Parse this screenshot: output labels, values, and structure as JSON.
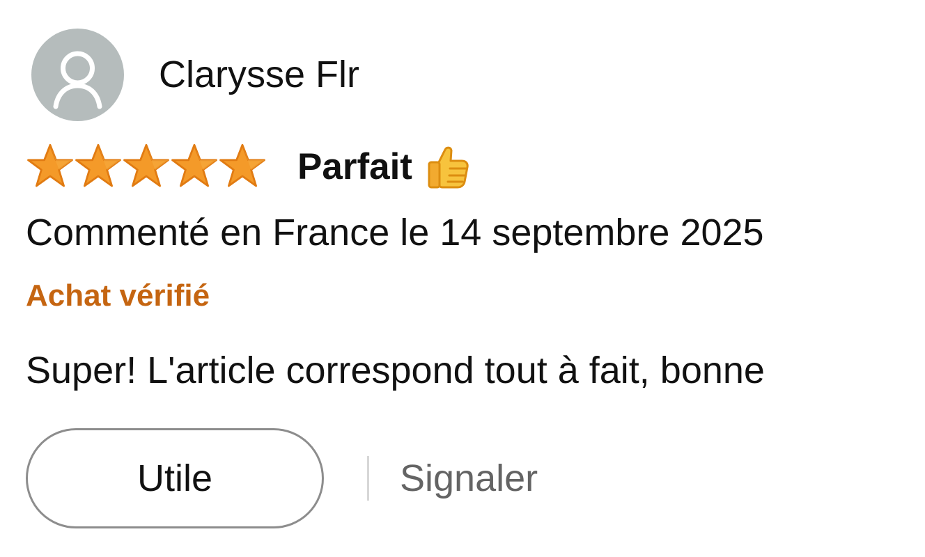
{
  "review": {
    "author": {
      "name": "Clarysse Flr",
      "avatar_icon": "person-outline-icon",
      "avatar_color": "#b5bcbc"
    },
    "rating": {
      "value": 5,
      "max": 5,
      "star_icon": "star-icon",
      "star_color": "#f49a29"
    },
    "title": "Parfait",
    "title_icon": "thumbs-up-icon",
    "date_text": "Commenté en France le 14 septembre 2025",
    "verified_label": "Achat vérifié",
    "verified_color": "#c56511",
    "body": "Super! L'article correspond tout à fait, bonne",
    "actions": {
      "helpful_label": "Utile",
      "report_label": "Signaler"
    }
  }
}
